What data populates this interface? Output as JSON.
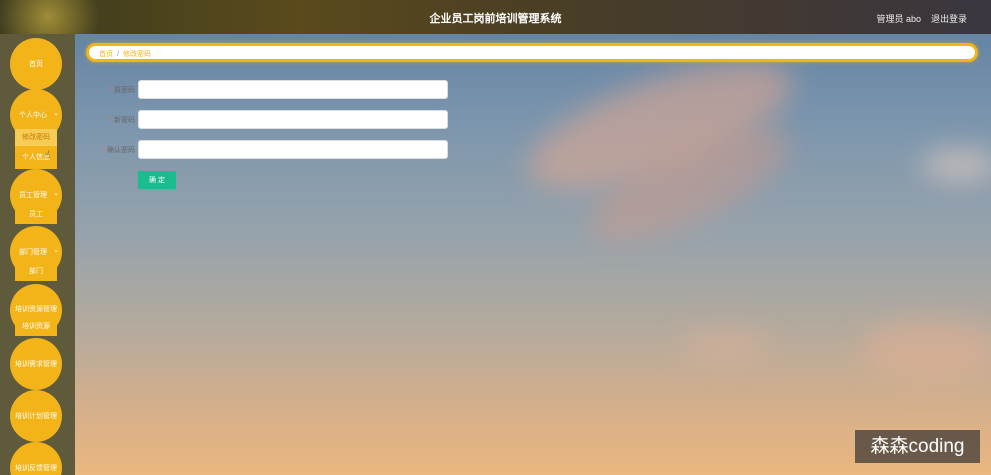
{
  "header": {
    "title": "企业员工岗前培训管理系统",
    "admin_label": "管理员 abo",
    "logout_label": "退出登录"
  },
  "sidebar": {
    "items": [
      {
        "label": "首页"
      },
      {
        "label": "个人中心",
        "sub": [
          "修改密码",
          "个人信息"
        ]
      },
      {
        "label": "员工管理",
        "sub": [
          "员工"
        ]
      },
      {
        "label": "部门管理",
        "sub": [
          "部门"
        ]
      },
      {
        "label": "培训资源管理",
        "sub": [
          "培训资源"
        ]
      },
      {
        "label": "培训需求管理"
      },
      {
        "label": "培训计划管理"
      },
      {
        "label": "培训反馈管理"
      }
    ]
  },
  "breadcrumb": {
    "home": "首页",
    "separator": "/",
    "current": "修改密码"
  },
  "form": {
    "old_password_label": "原密码",
    "new_password_label": "新密码",
    "confirm_password_label": "确认密码",
    "old_password_value": "",
    "new_password_value": "",
    "confirm_password_value": "",
    "submit_label": "确 定"
  },
  "watermark": "森森coding",
  "colors": {
    "accent": "#f2b418",
    "button": "#1bbc8f",
    "sidebar_bg": "#5e5a3b"
  }
}
